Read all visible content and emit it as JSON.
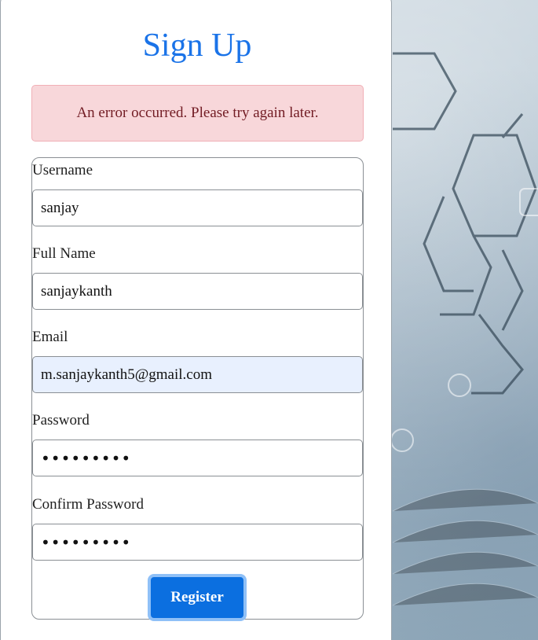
{
  "page": {
    "title": "Sign Up"
  },
  "alert": {
    "message": "An error occurred. Please try again later.",
    "color": "#f8d7da"
  },
  "form": {
    "username": {
      "label": "Username",
      "value": "sanjay"
    },
    "full_name": {
      "label": "Full Name",
      "value": "sanjaykanth"
    },
    "email": {
      "label": "Email",
      "value": "m.sanjaykanth5@gmail.com"
    },
    "password": {
      "label": "Password",
      "value": "•••••••••"
    },
    "confirm_password": {
      "label": "Confirm Password",
      "value": "•••••••••"
    },
    "register_label": "Register"
  },
  "colors": {
    "accent": "#1a73e8",
    "button": "#0b6fe0"
  }
}
